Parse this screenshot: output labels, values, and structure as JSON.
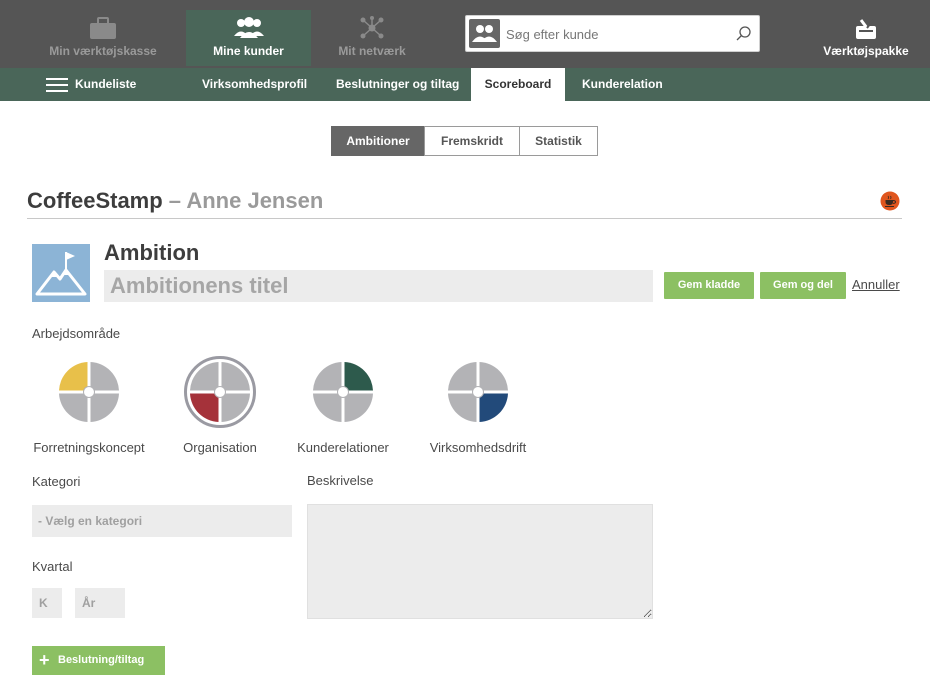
{
  "topnav": {
    "toolbox": "Min værktøjskasse",
    "customers": "Mine kunder",
    "network": "Mit netværk",
    "search_placeholder": "Søg efter kunde",
    "toolkit": "Værktøjspakke"
  },
  "subnav": {
    "list": "Kundeliste",
    "profile": "Virksomhedsprofil",
    "decisions": "Beslutninger og tiltag",
    "scoreboard": "Scoreboard",
    "relation": "Kunderelation"
  },
  "tabs": {
    "ambitions": "Ambitioner",
    "progress": "Fremskridt",
    "stats": "Statistik"
  },
  "heading": {
    "company": "CoffeeStamp",
    "separator": " – ",
    "person": "Anne Jensen"
  },
  "ambition": {
    "label": "Ambition",
    "title_placeholder": "Ambitionens titel",
    "save_draft": "Gem kladde",
    "save_share": "Gem og del",
    "cancel": "Annuller"
  },
  "work_area": {
    "label": "Arbejdsområde",
    "items": [
      {
        "name": "Forretningskoncept",
        "color": "#e8c04a",
        "quadrant": "top-left",
        "selected": false
      },
      {
        "name": "Organisation",
        "color": "#a5323a",
        "quadrant": "bottom-left",
        "selected": true
      },
      {
        "name": "Kunderelationer",
        "color": "#2d5a4c",
        "quadrant": "top-right",
        "selected": false
      },
      {
        "name": "Virksomhedsdrift",
        "color": "#224a7a",
        "quadrant": "bottom-right",
        "selected": false
      }
    ]
  },
  "form": {
    "category_label": "Kategori",
    "category_placeholder": "- Vælg en kategori",
    "description_label": "Beskrivelse",
    "quarter_label": "Kvartal",
    "quarter_k": "K",
    "quarter_year": "År",
    "add_decision": "Beslutning/tiltag"
  },
  "colors": {
    "topbar": "#555555",
    "subbar": "#4a6659",
    "green_button": "#8cc063",
    "quadrant_gray": "#b3b3b6"
  }
}
